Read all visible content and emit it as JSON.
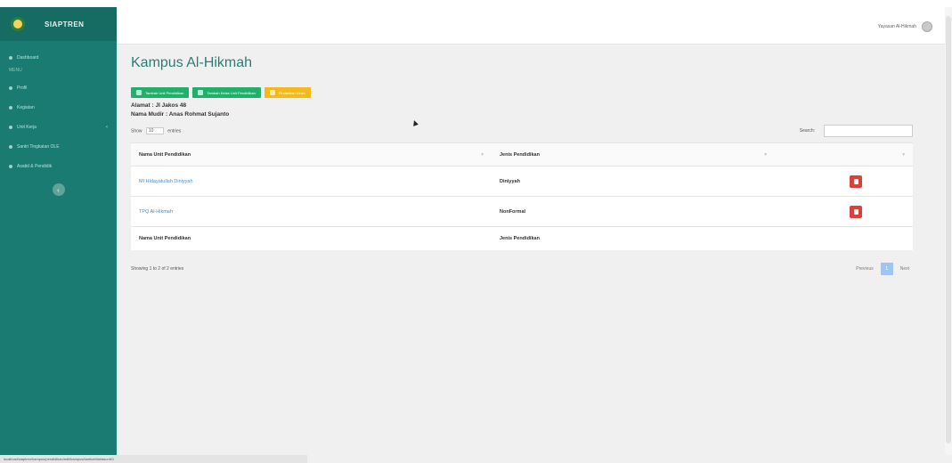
{
  "app": {
    "brand": "SIAPTREN"
  },
  "sidebar": {
    "items": [
      {
        "label": "Dashboard"
      },
      {
        "label": "MENU",
        "header": true
      },
      {
        "label": "Profil"
      },
      {
        "label": "Kegiatan"
      },
      {
        "label": "Unit Kerja",
        "caret": "‹"
      },
      {
        "label": "Santri Tingkatan OLE"
      },
      {
        "label": "Asatid & Pendidik"
      }
    ],
    "toggle_label": "‹"
  },
  "header": {
    "user_name": "Yayasan Al-Hikmah"
  },
  "page": {
    "title": "Kampus Al-Hikmah",
    "buttons": [
      {
        "label": "Tambah Unit Pendidikan",
        "color": "#21b06b"
      },
      {
        "label": "Tambah Kelas Unit Pendidikan",
        "color": "#21b06b"
      },
      {
        "label": "Pindahkan Kelas",
        "color": "#f5b91a"
      }
    ],
    "alamat": "Alamat : Jl Jakos 48",
    "mudir": "Nama Mudir : Anas Rohmat Sujanto"
  },
  "table": {
    "show_label": "Show",
    "show_value": "10",
    "entries_label": "entries",
    "search_label": "Search:",
    "search_value": "",
    "columns": [
      "Nama Unit Pendidikan",
      "Jenis Pendidikan",
      ""
    ],
    "rows": [
      {
        "unit": "MI Hidayatullah Diniyyah",
        "jenis": "Diniyyah"
      },
      {
        "unit": "TPQ Al-Hikmah",
        "jenis": "NonFormal"
      }
    ],
    "footer_columns": [
      "Nama Unit Pendidikan",
      "Jenis Pendidikan",
      ""
    ],
    "info": "Showing 1 to 2 of 2 entries",
    "pagination": {
      "previous": "Previous",
      "current": "1",
      "next": "Next"
    }
  },
  "status_url": "localhost/siaptren/kampus/pendidikan/edit/kampus/tambah/kelasunit/1"
}
